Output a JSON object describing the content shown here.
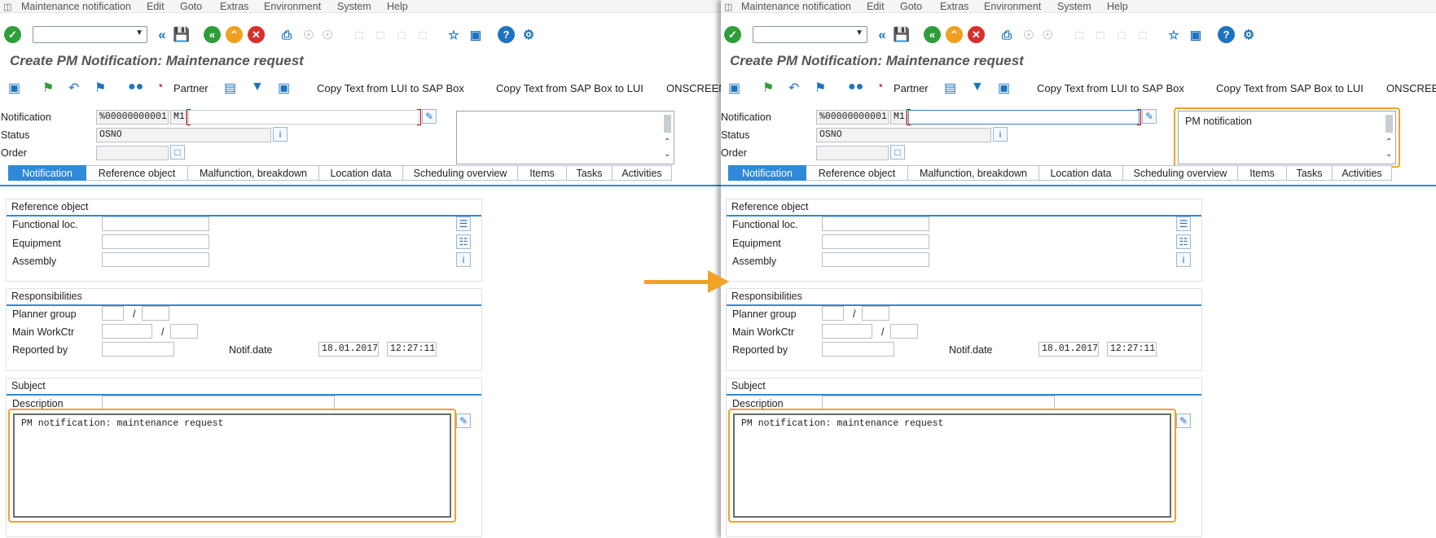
{
  "menu": [
    "Maintenance notification",
    "Edit",
    "Goto",
    "Extras",
    "Environment",
    "System",
    "Help"
  ],
  "icons": {
    "enter": "check-icon",
    "back": "back-icon",
    "save": "save-icon",
    "exit": "exit-icon",
    "cancel": "cancel-icon",
    "print": "print-icon",
    "find": "find-icon",
    "help": "help-icon",
    "settings": "gear-icon"
  },
  "title": "Create PM Notification: Maintenance request",
  "app_toolbar": {
    "partner": "Partner",
    "copy_lui_to_sap": "Copy Text from LUI to SAP Box",
    "copy_sap_to_lui": "Copy Text from SAP Box to LUI",
    "onscreen": "ONSCREEN"
  },
  "header": {
    "notification_label": "Notification",
    "notification_value": "%00000000001",
    "notification_type": "M1",
    "status_label": "Status",
    "status_value": "OSNO",
    "order_label": "Order"
  },
  "panels": {
    "left": {
      "longtext": ""
    },
    "right": {
      "longtext": "PM notification"
    }
  },
  "tabs": [
    "Notification",
    "Reference object",
    "Malfunction, breakdown",
    "Location data",
    "Scheduling overview",
    "Items",
    "Tasks",
    "Activities"
  ],
  "reference_object": {
    "title": "Reference object",
    "functional_loc": "Functional loc.",
    "equipment": "Equipment",
    "assembly": "Assembly"
  },
  "responsibilities": {
    "title": "Responsibilities",
    "planner_group": "Planner group",
    "main_workctr": "Main WorkCtr",
    "reported_by": "Reported by",
    "slash": "/",
    "notif_date_label": "Notif.date",
    "notif_date": "18.01.2017",
    "notif_time": "12:27:11"
  },
  "subject": {
    "title": "Subject",
    "description": "Description",
    "text": "PM notification: maintenance request"
  },
  "colors": {
    "accent": "#2e8ad8",
    "highlight": "#f2a224",
    "enter_green": "#2e9e3a",
    "exit_orange": "#f0a020",
    "cancel_red": "#d9302c"
  }
}
